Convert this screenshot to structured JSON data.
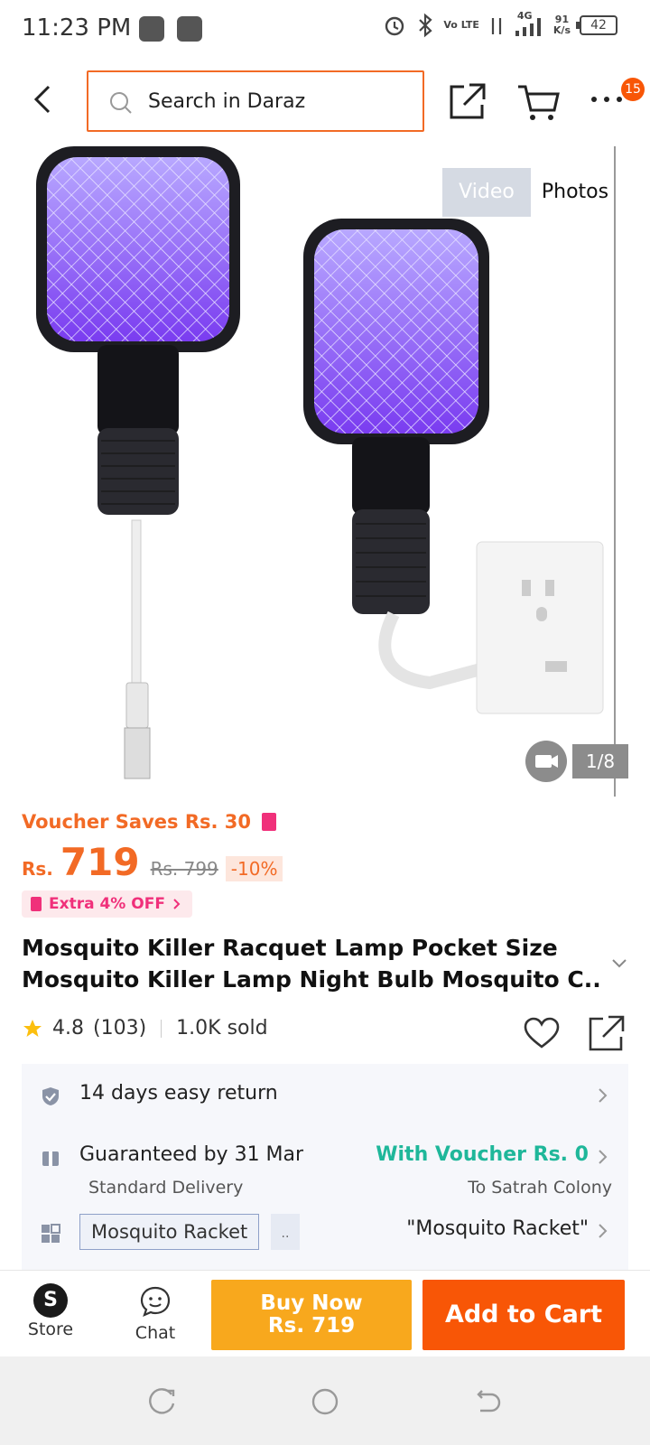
{
  "status_bar": {
    "time": "11:23 PM",
    "lte": "Vo LTE",
    "net": "4G",
    "speed_top": "91",
    "speed_bottom": "K/s",
    "battery": "42"
  },
  "top_nav": {
    "search_placeholder": "Search in Daraz",
    "cart_badge": "15"
  },
  "media": {
    "video_label": "Video",
    "photos_label": "Photos",
    "counter": "1/8"
  },
  "voucher": {
    "label": "Voucher Saves Rs. 30"
  },
  "price": {
    "currency": "Rs.",
    "value": "719",
    "old": "Rs. 799",
    "discount": "-10%"
  },
  "extra_off": "Extra 4% OFF",
  "product": {
    "title_line1": "Mosquito Killer Racquet Lamp Pocket Size",
    "title_line2": "Mosquito Killer Lamp Night Bulb Mosquito C..."
  },
  "rating": {
    "score": "4.8",
    "count": "(103)",
    "sold": "1.0K sold"
  },
  "info": {
    "return": "14 days easy return",
    "delivery": "Guaranteed by 31 Mar",
    "delivery_type": "Standard Delivery",
    "voucher_delivery": "With Voucher Rs. 0",
    "destination": "To Satrah Colony",
    "variant_chip": "Mosquito Racket",
    "variant_more": "..",
    "variant_value": "\"Mosquito Racket\""
  },
  "bottom": {
    "store": "Store",
    "chat": "Chat",
    "buy_now_line1": "Buy Now",
    "buy_now_line2": "Rs. 719",
    "add_to_cart": "Add to Cart"
  },
  "colors": {
    "accent": "#f85606",
    "buy_now": "#f8a81d",
    "voucher_green": "#1fb79a",
    "pink": "#f0307a"
  }
}
